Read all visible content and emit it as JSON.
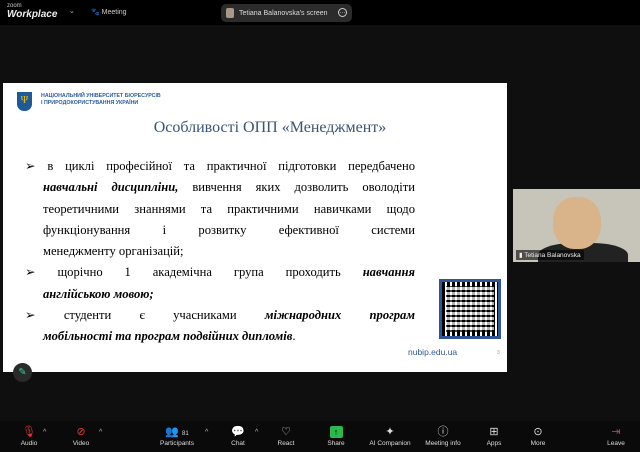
{
  "topbar": {
    "brand_small": "zoom",
    "brand": "Workplace",
    "meeting": "Meeting",
    "share_label": "Tetiana Balanovska's screen"
  },
  "slide": {
    "university": [
      "НАЦІОНАЛЬНИЙ УНІВЕРСИТЕТ БІОРЕСУРСІВ",
      "І ПРИРОДОКОРИСТУВАННЯ УКРАЇНИ"
    ],
    "title": "Особливості  ОПП «Менеджмент»",
    "bullet": "➢",
    "p1": {
      "l1": "в циклі професійної та практичної підготовки передбачено",
      "l2b": "навчальні дисципліни,",
      "l2": " вивчення яких дозволить оволодіти",
      "l3": "теоретичними знаннями та практичними навичками щодо",
      "l4": "функціонування і розвитку ефективної системи",
      "l5": "менеджменту організацій;"
    },
    "p2": {
      "l1": "щорічно 1 академічна група проходить ",
      "l1b": "навчання",
      "l2b": "англійською мовою;"
    },
    "p3": {
      "l1": "студенти є учасниками ",
      "l1b": "міжнародних програм",
      "l2b": "мобільності та програм подвійних дипломів",
      "l2": "."
    },
    "url": "nubip.edu.ua",
    "page": "3"
  },
  "video": {
    "name": "Tetiana Balanovska"
  },
  "toolbar": {
    "audio": "Audio",
    "video": "Video",
    "participants": "Participants",
    "participants_count": "81",
    "chat": "Chat",
    "react": "React",
    "share": "Share",
    "ai": "AI Companion",
    "info": "Meeting info",
    "apps": "Apps",
    "more": "More",
    "leave": "Leave"
  }
}
